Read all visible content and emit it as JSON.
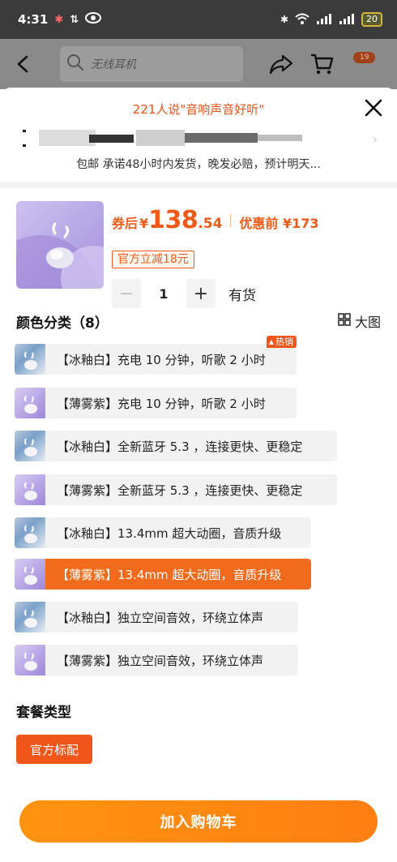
{
  "status_bar": {
    "time": "4:31",
    "battery": "20"
  },
  "header": {
    "search_placeholder": "无线耳机",
    "more_badge": "19"
  },
  "sheet": {
    "review_banner": "221人说\"音响声音好听\"",
    "shipping_text": "包邮 承诺48小时内发货，晚发必赔，预计明天..."
  },
  "product": {
    "price_label": "券后",
    "currency": "¥",
    "price_integer": "138",
    "price_decimal": ".54",
    "original_price": "优惠前 ¥173",
    "discount_tag": "官方立减18元",
    "quantity": "1",
    "stock_status": "有货"
  },
  "color_section": {
    "title": "颜色分类（8）",
    "big_view_label": "大图",
    "options": [
      {
        "label": "【冰釉白】充电 10 分钟，听歌 2 小时",
        "variant": "white",
        "badge": "热销"
      },
      {
        "label": "【薄雾紫】充电 10 分钟，听歌 2 小时",
        "variant": "purple"
      },
      {
        "label": "【冰釉白】全新蓝牙 5.3 ，连接更快、更稳定",
        "variant": "white"
      },
      {
        "label": "【薄雾紫】全新蓝牙 5.3 ，连接更快、更稳定",
        "variant": "purple"
      },
      {
        "label": "【冰釉白】13.4mm 超大动圈，音质升级",
        "variant": "white"
      },
      {
        "label": "【薄雾紫】13.4mm 超大动圈，音质升级",
        "variant": "purple",
        "selected": true
      },
      {
        "label": "【冰釉白】独立空间音效，环绕立体声",
        "variant": "white"
      },
      {
        "label": "【薄雾紫】独立空间音效，环绕立体声",
        "variant": "purple"
      }
    ]
  },
  "package_section": {
    "title": "套餐类型",
    "option": "官方标配"
  },
  "footer": {
    "add_to_cart": "加入购物车"
  },
  "colors": {
    "accent": "#f0561a",
    "cart_button": "#ff8a12"
  }
}
